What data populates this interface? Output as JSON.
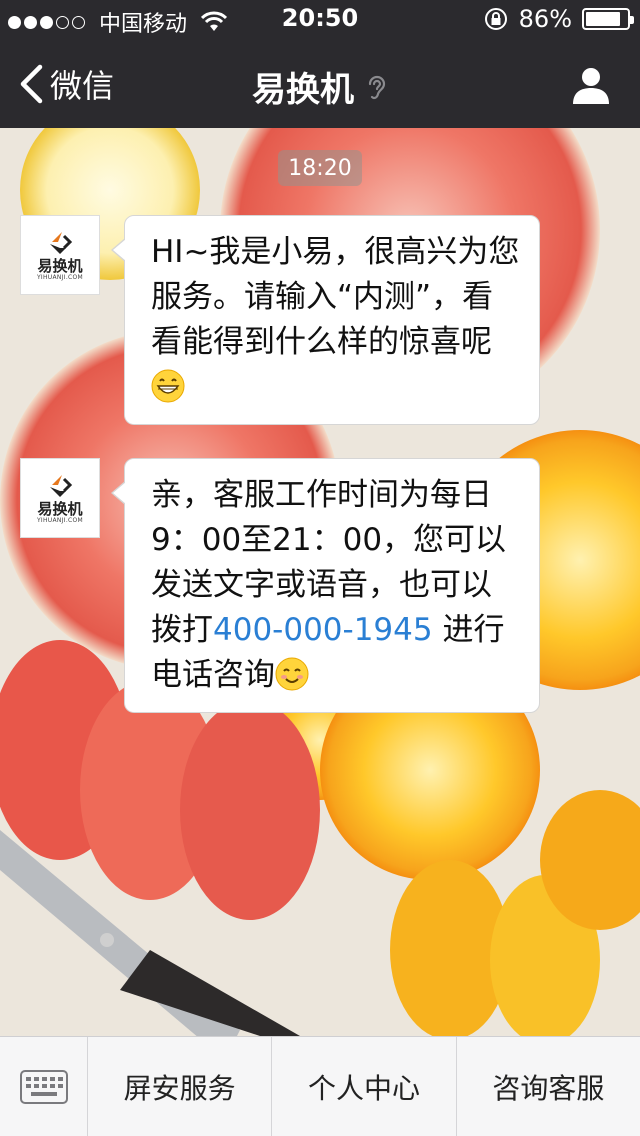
{
  "status_bar": {
    "signal_dots": [
      true,
      true,
      true,
      false,
      false
    ],
    "carrier": "中国移动",
    "time": "20:50",
    "battery": "86%",
    "battery_level": 0.86
  },
  "nav": {
    "back_label": "微信",
    "title": "易换机"
  },
  "chat": {
    "timestamp": "18:20",
    "sender": {
      "logo_cn": "易换机",
      "logo_en": "YIHUANJI.COM"
    },
    "messages": [
      {
        "text": "HI~我是小易，很高兴为您服务。请输入“内测”，看看能得到什么样的惊喜呢",
        "emoji": "grinning-face"
      },
      {
        "text_before": "亲，客服工作时间为每日9：00至21：00，您可以发送文字或语音，也可以拨打",
        "phone": "400-000-1945",
        "text_after": " 进行电话咨询",
        "emoji": "smiling-face"
      }
    ]
  },
  "menu": {
    "items": [
      "屏安服务",
      "个人中心",
      "咨询客服"
    ]
  }
}
